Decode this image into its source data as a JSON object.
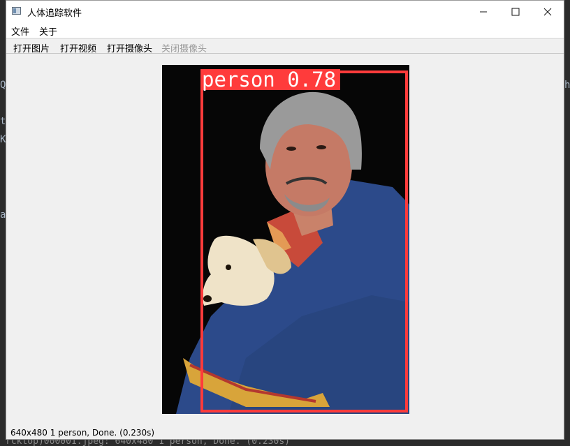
{
  "window": {
    "title": "人体追踪软件",
    "buttons": [
      "minimize",
      "maximize",
      "close"
    ]
  },
  "menu": {
    "items": [
      "文件",
      "关于"
    ]
  },
  "toolbar": {
    "open_image": "打开图片",
    "open_video": "打开视频",
    "open_camera": "打开摄像头",
    "close_camera": "关闭摄像头"
  },
  "detection": {
    "label": "person 0.78",
    "color": "#ff3b3b"
  },
  "status": {
    "text": "640x480 1 person, Done. (0.230s)"
  },
  "background": {
    "bottom_line": "rcktop)000001.jpeg: 640x480 1 person, Done. (0.230s)"
  }
}
